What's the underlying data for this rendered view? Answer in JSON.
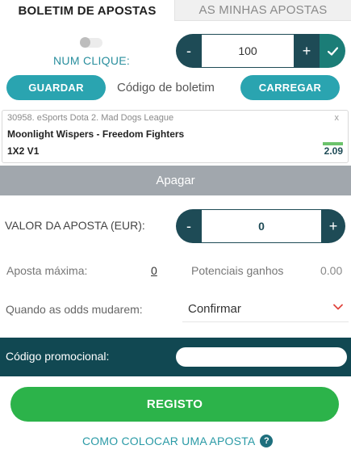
{
  "tabs": {
    "betslip": "BOLETIM DE APOSTAS",
    "my_bets": "AS MINHAS APOSTAS"
  },
  "one_click": {
    "label": "NUM CLIQUE:",
    "enabled": false,
    "minus": "-",
    "value": "100",
    "plus": "+",
    "confirm_icon": "check-icon"
  },
  "booking": {
    "save_label": "GUARDAR",
    "code_label": "Código de boletim",
    "load_label": "CARREGAR"
  },
  "bet": {
    "league": "30958. eSports Dota 2. Mad Dogs League",
    "close": "x",
    "match": "Moonlight Wispers - Freedom Fighters",
    "market": "1X2 V1",
    "odds": "2.09"
  },
  "clear_label": "Apagar",
  "stake": {
    "label": "VALOR DA APOSTA (EUR):",
    "minus": "-",
    "value": "0",
    "plus": "+"
  },
  "limits": {
    "max_label": "Aposta máxima:",
    "max_value": "0",
    "winnings_label": "Potenciais ganhos",
    "winnings_value": "0.00"
  },
  "odds_change": {
    "label": "Quando as odds mudarem:",
    "selected": "Confirmar"
  },
  "promo": {
    "label": "Código promocional:",
    "value": ""
  },
  "register_label": "REGISTO",
  "how_to_label": "COMO COLOCAR UMA APOSTA",
  "colors": {
    "dark_teal": "#1e4b56",
    "accent_teal": "#2aa4b0",
    "green": "#2cb34a",
    "promo_bg": "#114852"
  }
}
